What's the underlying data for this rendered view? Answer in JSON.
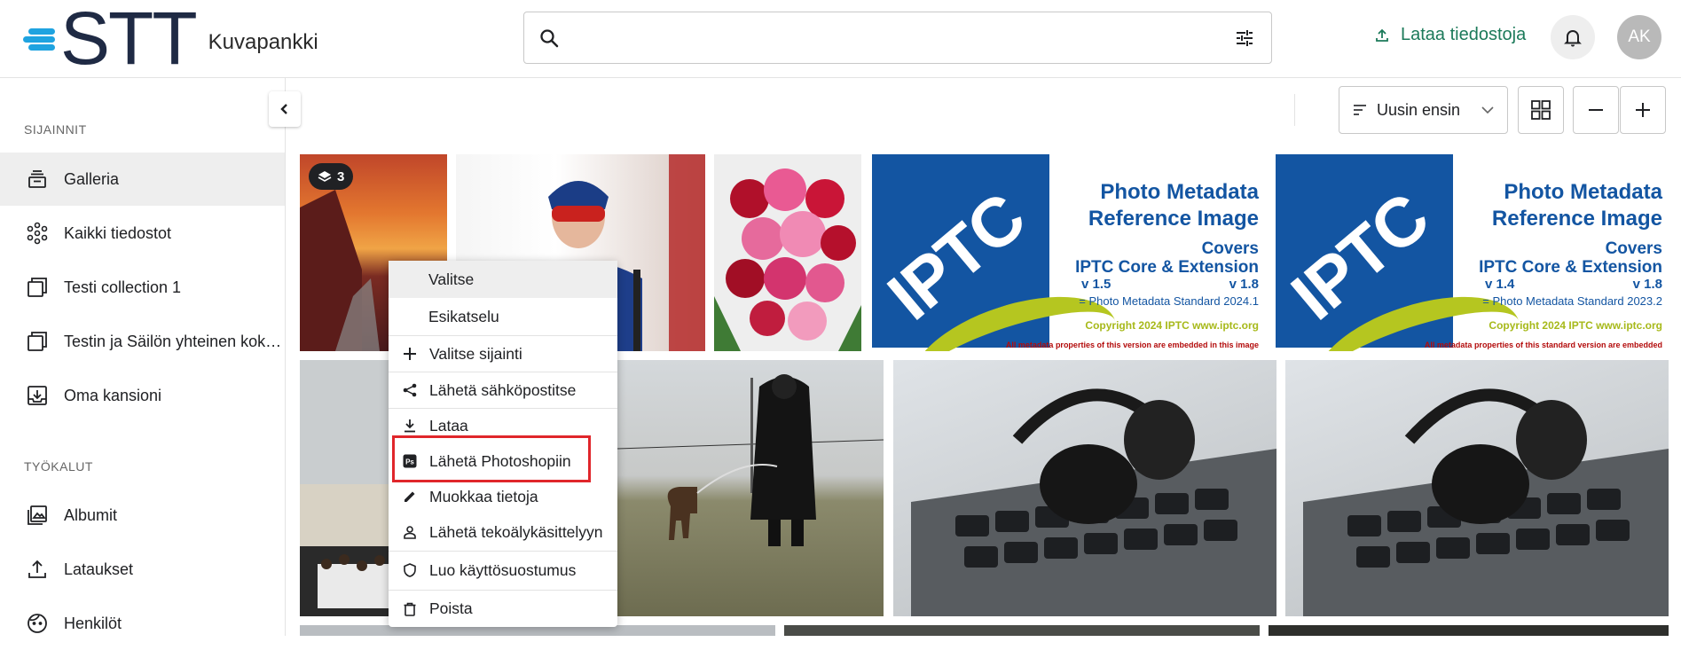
{
  "app": {
    "logo_text": "STT",
    "subtitle": "Kuvapankki",
    "upload_label": "Lataa tiedostoja",
    "avatar_initials": "AK",
    "accent_color": "#1c7a5a",
    "logo_color": "#1fa3e0"
  },
  "search": {
    "placeholder": "",
    "value": ""
  },
  "sidebar": {
    "section_locations": "SIJAINNIT",
    "locations": [
      {
        "label": "Galleria",
        "icon": "gallery-stack-icon",
        "active": true
      },
      {
        "label": "Kaikki tiedostot",
        "icon": "all-files-icon"
      },
      {
        "label": "Testi collection 1",
        "icon": "collection-icon"
      },
      {
        "label": "Testin ja Säilön yhteinen kok…",
        "icon": "collection-icon"
      },
      {
        "label": "Oma kansioni",
        "icon": "inbox-folder-icon"
      }
    ],
    "section_tools": "TYÖKALUT",
    "tools": [
      {
        "label": "Albumit",
        "icon": "album-icon"
      },
      {
        "label": "Lataukset",
        "icon": "upload-icon"
      },
      {
        "label": "Henkilöt",
        "icon": "face-icon"
      }
    ]
  },
  "toolbar": {
    "sort_label": "Uusin ensin"
  },
  "gallery": {
    "first_tile_badge": "3",
    "iptc_tiles": [
      {
        "title1": "Photo Metadata",
        "title2": "Reference Image",
        "covers": "Covers",
        "core": "IPTC Core & Extension",
        "v_left": "v 1.5",
        "v_right": "v 1.8",
        "standard": "= Photo Metadata Standard 2024.1",
        "copyright": "Copyright  2024  IPTC  www.iptc.org",
        "note": "All metadata properties of this version are embedded in this image"
      },
      {
        "title1": "Photo Metadata",
        "title2": "Reference Image",
        "covers": "Covers",
        "core": "IPTC Core & Extension",
        "v_left": "v 1.4",
        "v_right": "v 1.8",
        "standard": "= Photo Metadata Standard 2023.2",
        "copyright": "Copyright  2024  IPTC  www.iptc.org",
        "note": "All metadata properties of this standard version are embedded"
      }
    ]
  },
  "context_menu": {
    "items": [
      {
        "label": "Valitse",
        "icon": ""
      },
      {
        "label": "Esikatselu",
        "icon": ""
      },
      {
        "label": "Valitse sijainti",
        "icon": "plus-icon"
      },
      {
        "label": "Lähetä sähköpostitse",
        "icon": "share-icon"
      },
      {
        "label": "Lataa",
        "icon": "download-icon"
      },
      {
        "label": "Lähetä Photoshopiin",
        "icon": "photoshop-icon"
      },
      {
        "label": "Muokkaa tietoja",
        "icon": "pencil-icon"
      },
      {
        "label": "Lähetä tekoälykäsittelyyn",
        "icon": "person-icon"
      },
      {
        "label": "Luo käyttösuostumus",
        "icon": "shield-icon"
      },
      {
        "label": "Poista",
        "icon": "trash-icon"
      }
    ],
    "highlight_color": "#e0262b"
  }
}
